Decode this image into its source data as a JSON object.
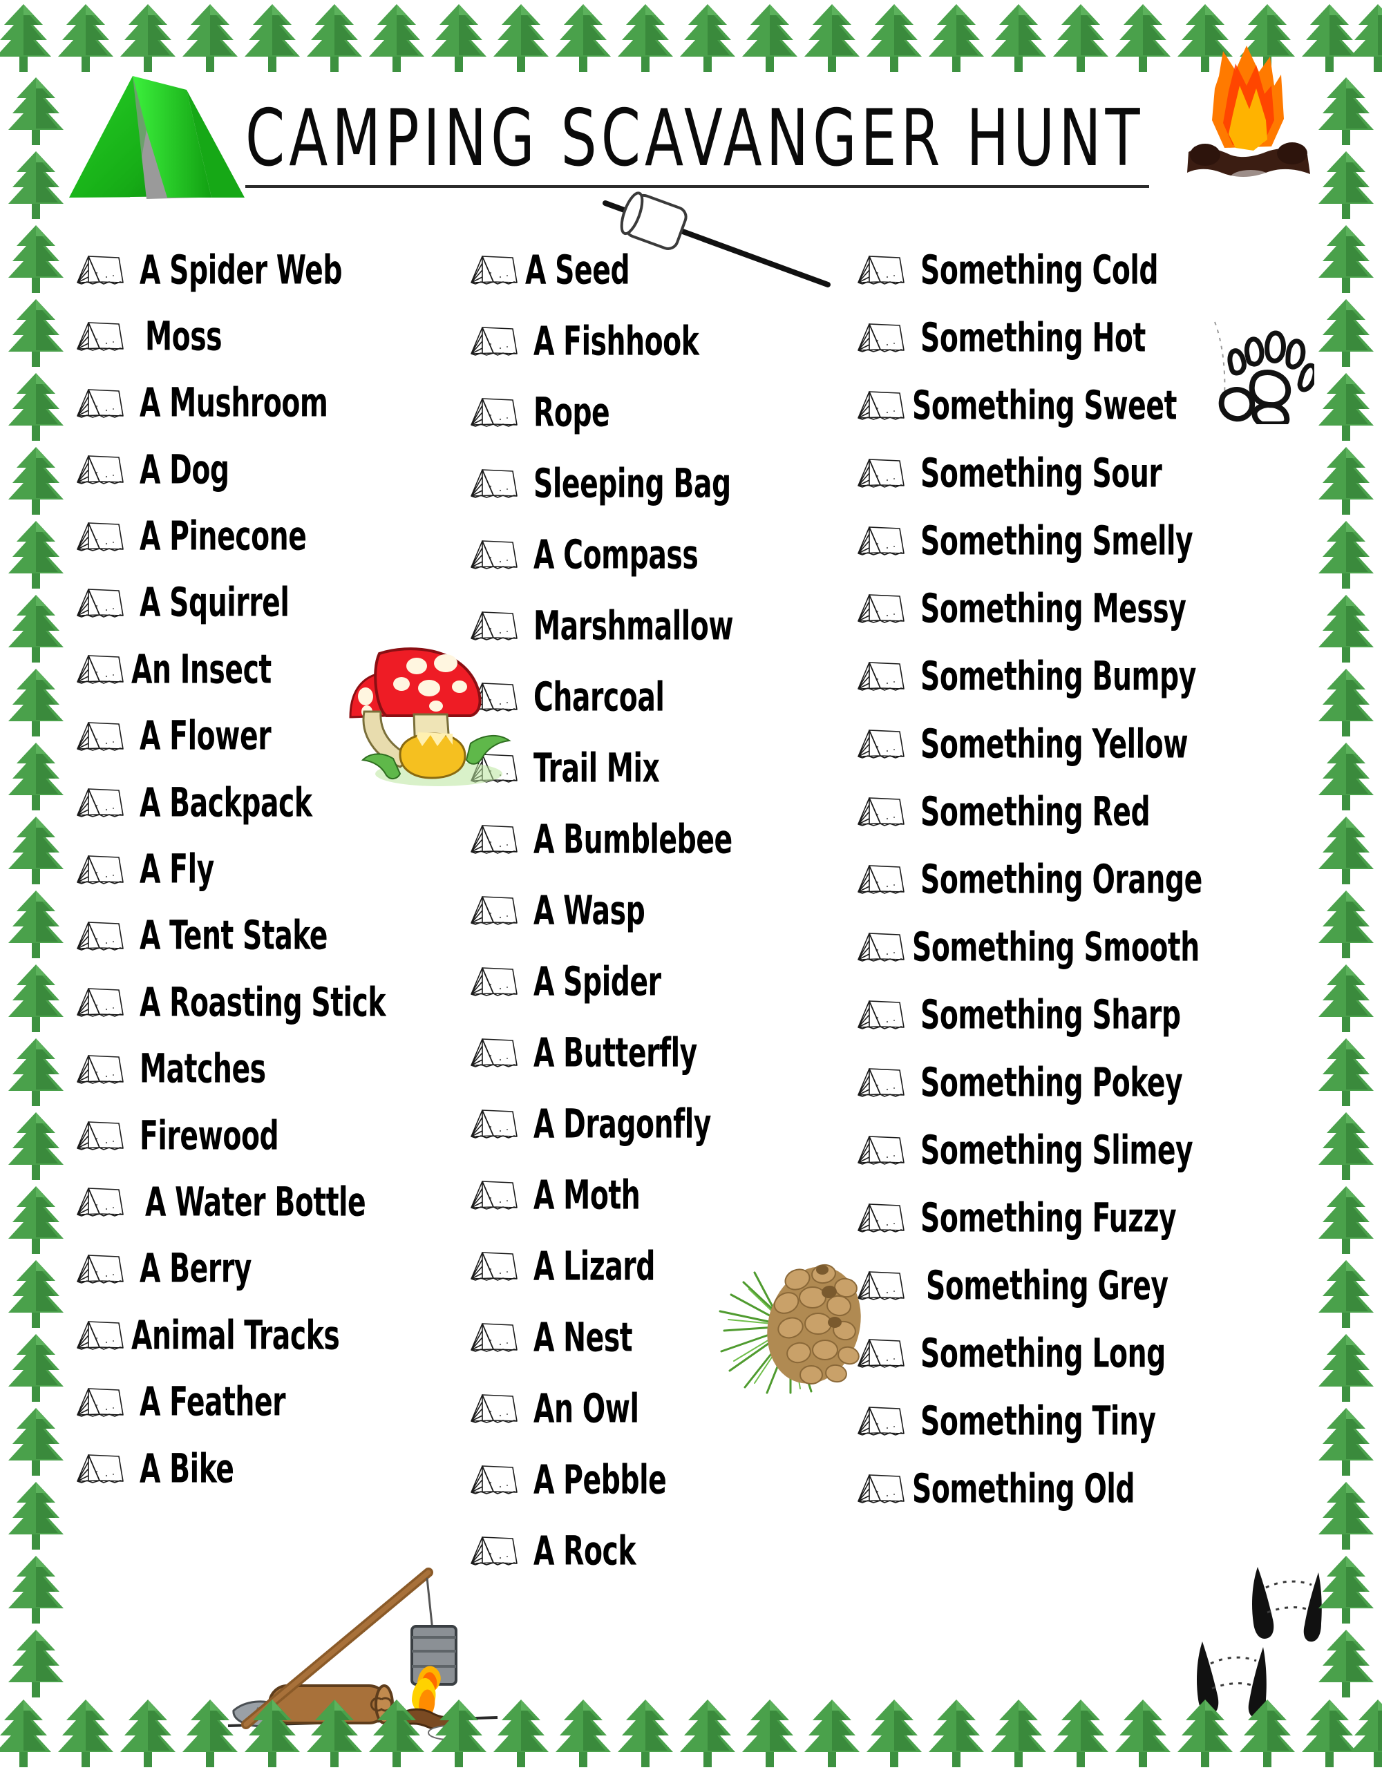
{
  "page": {
    "title": "CAMPING SCAVANGER HUNT",
    "background_color": "#ffffff",
    "tree_border_color": "#3f9b3f",
    "tent_color": "#22cc22",
    "flame_color": "#ff6a00",
    "mushroom_color": "#ee1c25",
    "text_color": "#000000"
  },
  "graphics": [
    {
      "name": "green-tent",
      "label": "Green A-frame tent"
    },
    {
      "name": "campfire",
      "label": "Campfire with flames"
    },
    {
      "name": "marshmallow-on-stick",
      "label": "Marshmallow on a roasting stick"
    },
    {
      "name": "mushrooms",
      "label": "Red mushrooms with white spots"
    },
    {
      "name": "pinecone",
      "label": "Pinecone with pine needles"
    },
    {
      "name": "bear-paw-print",
      "label": "Bear paw print"
    },
    {
      "name": "campfire-with-pot",
      "label": "Campfire with cooking pot on a stick"
    },
    {
      "name": "deer-tracks",
      "label": "Deer hoof tracks"
    }
  ],
  "columns": [
    {
      "id": "column-1",
      "items": [
        "A Spider Web",
        "Moss",
        "A Mushroom",
        "A Dog",
        "A Pinecone",
        "A Squirrel",
        "An Insect",
        "A Flower",
        "A Backpack",
        "A Fly",
        "A Tent Stake",
        "A Roasting Stick",
        "Matches",
        "Firewood",
        "A Water Bottle",
        "A Berry",
        "Animal Tracks",
        "A Feather",
        "A Bike"
      ]
    },
    {
      "id": "column-2",
      "items": [
        "A Seed",
        "A Fishhook",
        "Rope",
        "Sleeping Bag",
        "A Compass",
        "Marshmallow",
        "Charcoal",
        "Trail Mix",
        "A Bumblebee",
        "A Wasp",
        "A Spider",
        "A Butterfly",
        "A Dragonfly",
        "A Moth",
        "A Lizard",
        "A Nest",
        "An Owl",
        "A Pebble",
        "A Rock"
      ]
    },
    {
      "id": "column-3",
      "items": [
        "Something Cold",
        "Something Hot",
        "Something Sweet",
        "Something Sour",
        "Something Smelly",
        "Something Messy",
        "Something Bumpy",
        "Something Yellow",
        "Something Red",
        "Something Orange",
        "Something Smooth",
        "Something Sharp",
        "Something Pokey",
        "Something Slimey",
        "Something Fuzzy",
        "Something Grey",
        "Something Long",
        "Something Tiny",
        "Something Old"
      ]
    }
  ]
}
